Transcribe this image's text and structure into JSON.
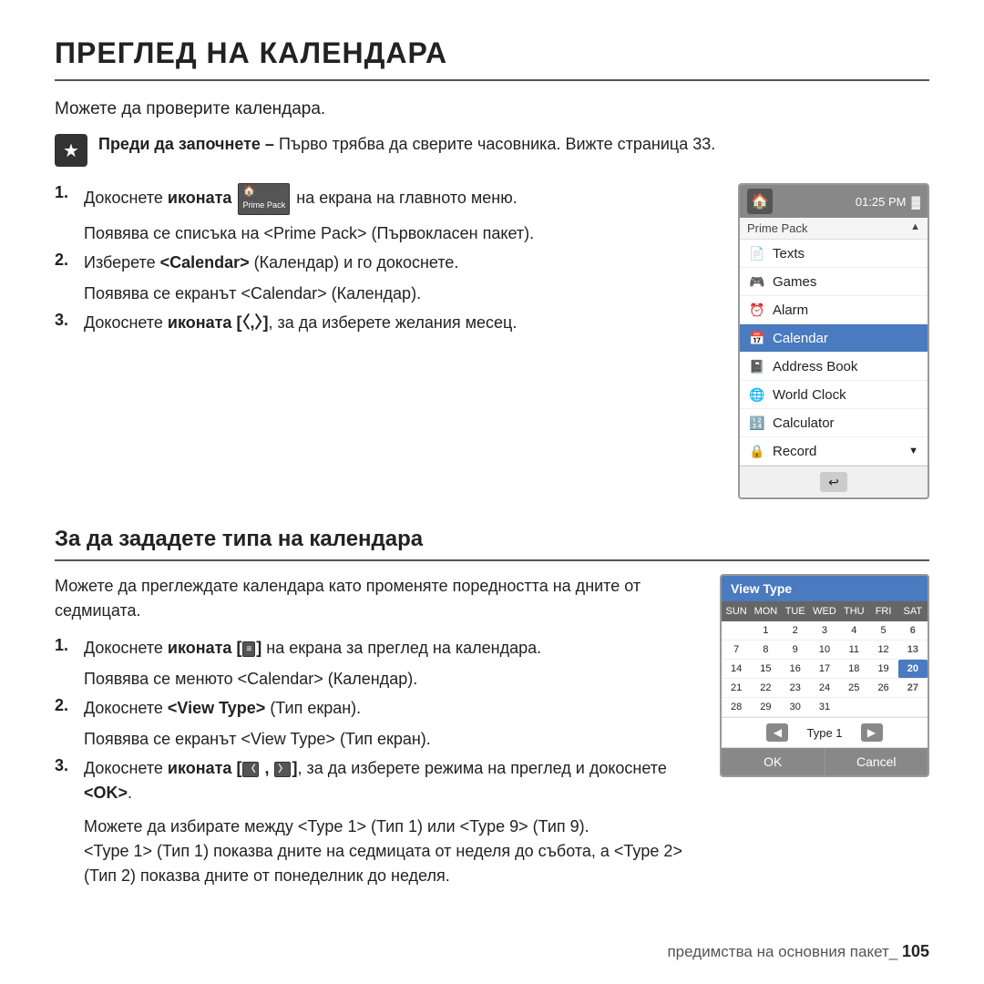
{
  "page": {
    "main_title": "ПРЕГЛЕД НА КАЛЕНДАРА",
    "intro": "Можете да проверите календара.",
    "note_label": "Преди да започнете –",
    "note_text": "Първо трябва да сверите часовника. Вижте страница 33.",
    "steps": [
      {
        "num": "1.",
        "text": "Докоснете иконата",
        "text2": "на екрана на главното меню.",
        "sub": "Появява се списъка на <Prime Pack> (Първокласен пакет)."
      },
      {
        "num": "2.",
        "text": "Изберете",
        "highlight": "<Calendar>",
        "text2": "(Календар) и го докоснете.",
        "sub": "Появява се екранът <Calendar> (Календар)."
      },
      {
        "num": "3.",
        "text": "Докоснете иконата [〈,〉], за да изберете желания месец.",
        "sub": ""
      }
    ],
    "phone_panel": {
      "header_time": "01:25 PM",
      "header_title": "Prime Pack",
      "menu_items": [
        {
          "label": "Texts",
          "icon": "📄",
          "selected": false
        },
        {
          "label": "Games",
          "icon": "🎮",
          "selected": false
        },
        {
          "label": "Alarm",
          "icon": "⏰",
          "selected": false
        },
        {
          "label": "Calendar",
          "icon": "📅",
          "selected": true
        },
        {
          "label": "Address Book",
          "icon": "📓",
          "selected": false
        },
        {
          "label": "World Clock",
          "icon": "🌐",
          "selected": false
        },
        {
          "label": "Calculator",
          "icon": "🔢",
          "selected": false
        },
        {
          "label": "Record",
          "icon": "🔒",
          "selected": false
        }
      ]
    },
    "section2": {
      "title": "За да зададете типа на календара",
      "intro": "Можете да преглеждате календара като променяте поредността на дните от седмицата.",
      "steps": [
        {
          "num": "1.",
          "text": "Докоснете иконата [",
          "icon_label": "≡",
          "text2": "] на екрана за преглед на календара.",
          "sub": "Появява се менюто <Calendar> (Календар)."
        },
        {
          "num": "2.",
          "text": "Докоснете",
          "highlight": "<View Type>",
          "text2": "(Тип екран).",
          "sub": "Появява се екранът <View Type> (Тип екран)."
        },
        {
          "num": "3.",
          "text": "Докоснете иконата [〈 , 〉], за да изберете режима на преглед и докоснете <OK>.",
          "sub": "Можете да избирате между <Type 1> (Тип 1) или <Type 9> (Тип 9).\n<Type 1> (Тип 1) показва дните на седмицата от неделя до събота, а <Type 2> (Тип 2) показва дните от понеделник до неделя."
        }
      ],
      "calendar_panel": {
        "title": "View Type",
        "days_header": [
          "SUN",
          "MON",
          "TUE",
          "WED",
          "THU",
          "FRI",
          "SAT"
        ],
        "weeks": [
          [
            "",
            "1",
            "2",
            "3",
            "4",
            "5",
            "6"
          ],
          [
            "7",
            "8",
            "9",
            "10",
            "11",
            "12",
            "13"
          ],
          [
            "14",
            "15",
            "16",
            "17",
            "18",
            "19",
            "20"
          ],
          [
            "21",
            "22",
            "23",
            "24",
            "25",
            "26",
            "27"
          ],
          [
            "28",
            "29",
            "30",
            "31",
            "",
            "",
            ""
          ]
        ],
        "nav_type": "Type 1",
        "ok_label": "OK",
        "cancel_label": "Cancel"
      }
    },
    "footer": {
      "text": "предимства на основния пакет_",
      "page": "105"
    }
  }
}
